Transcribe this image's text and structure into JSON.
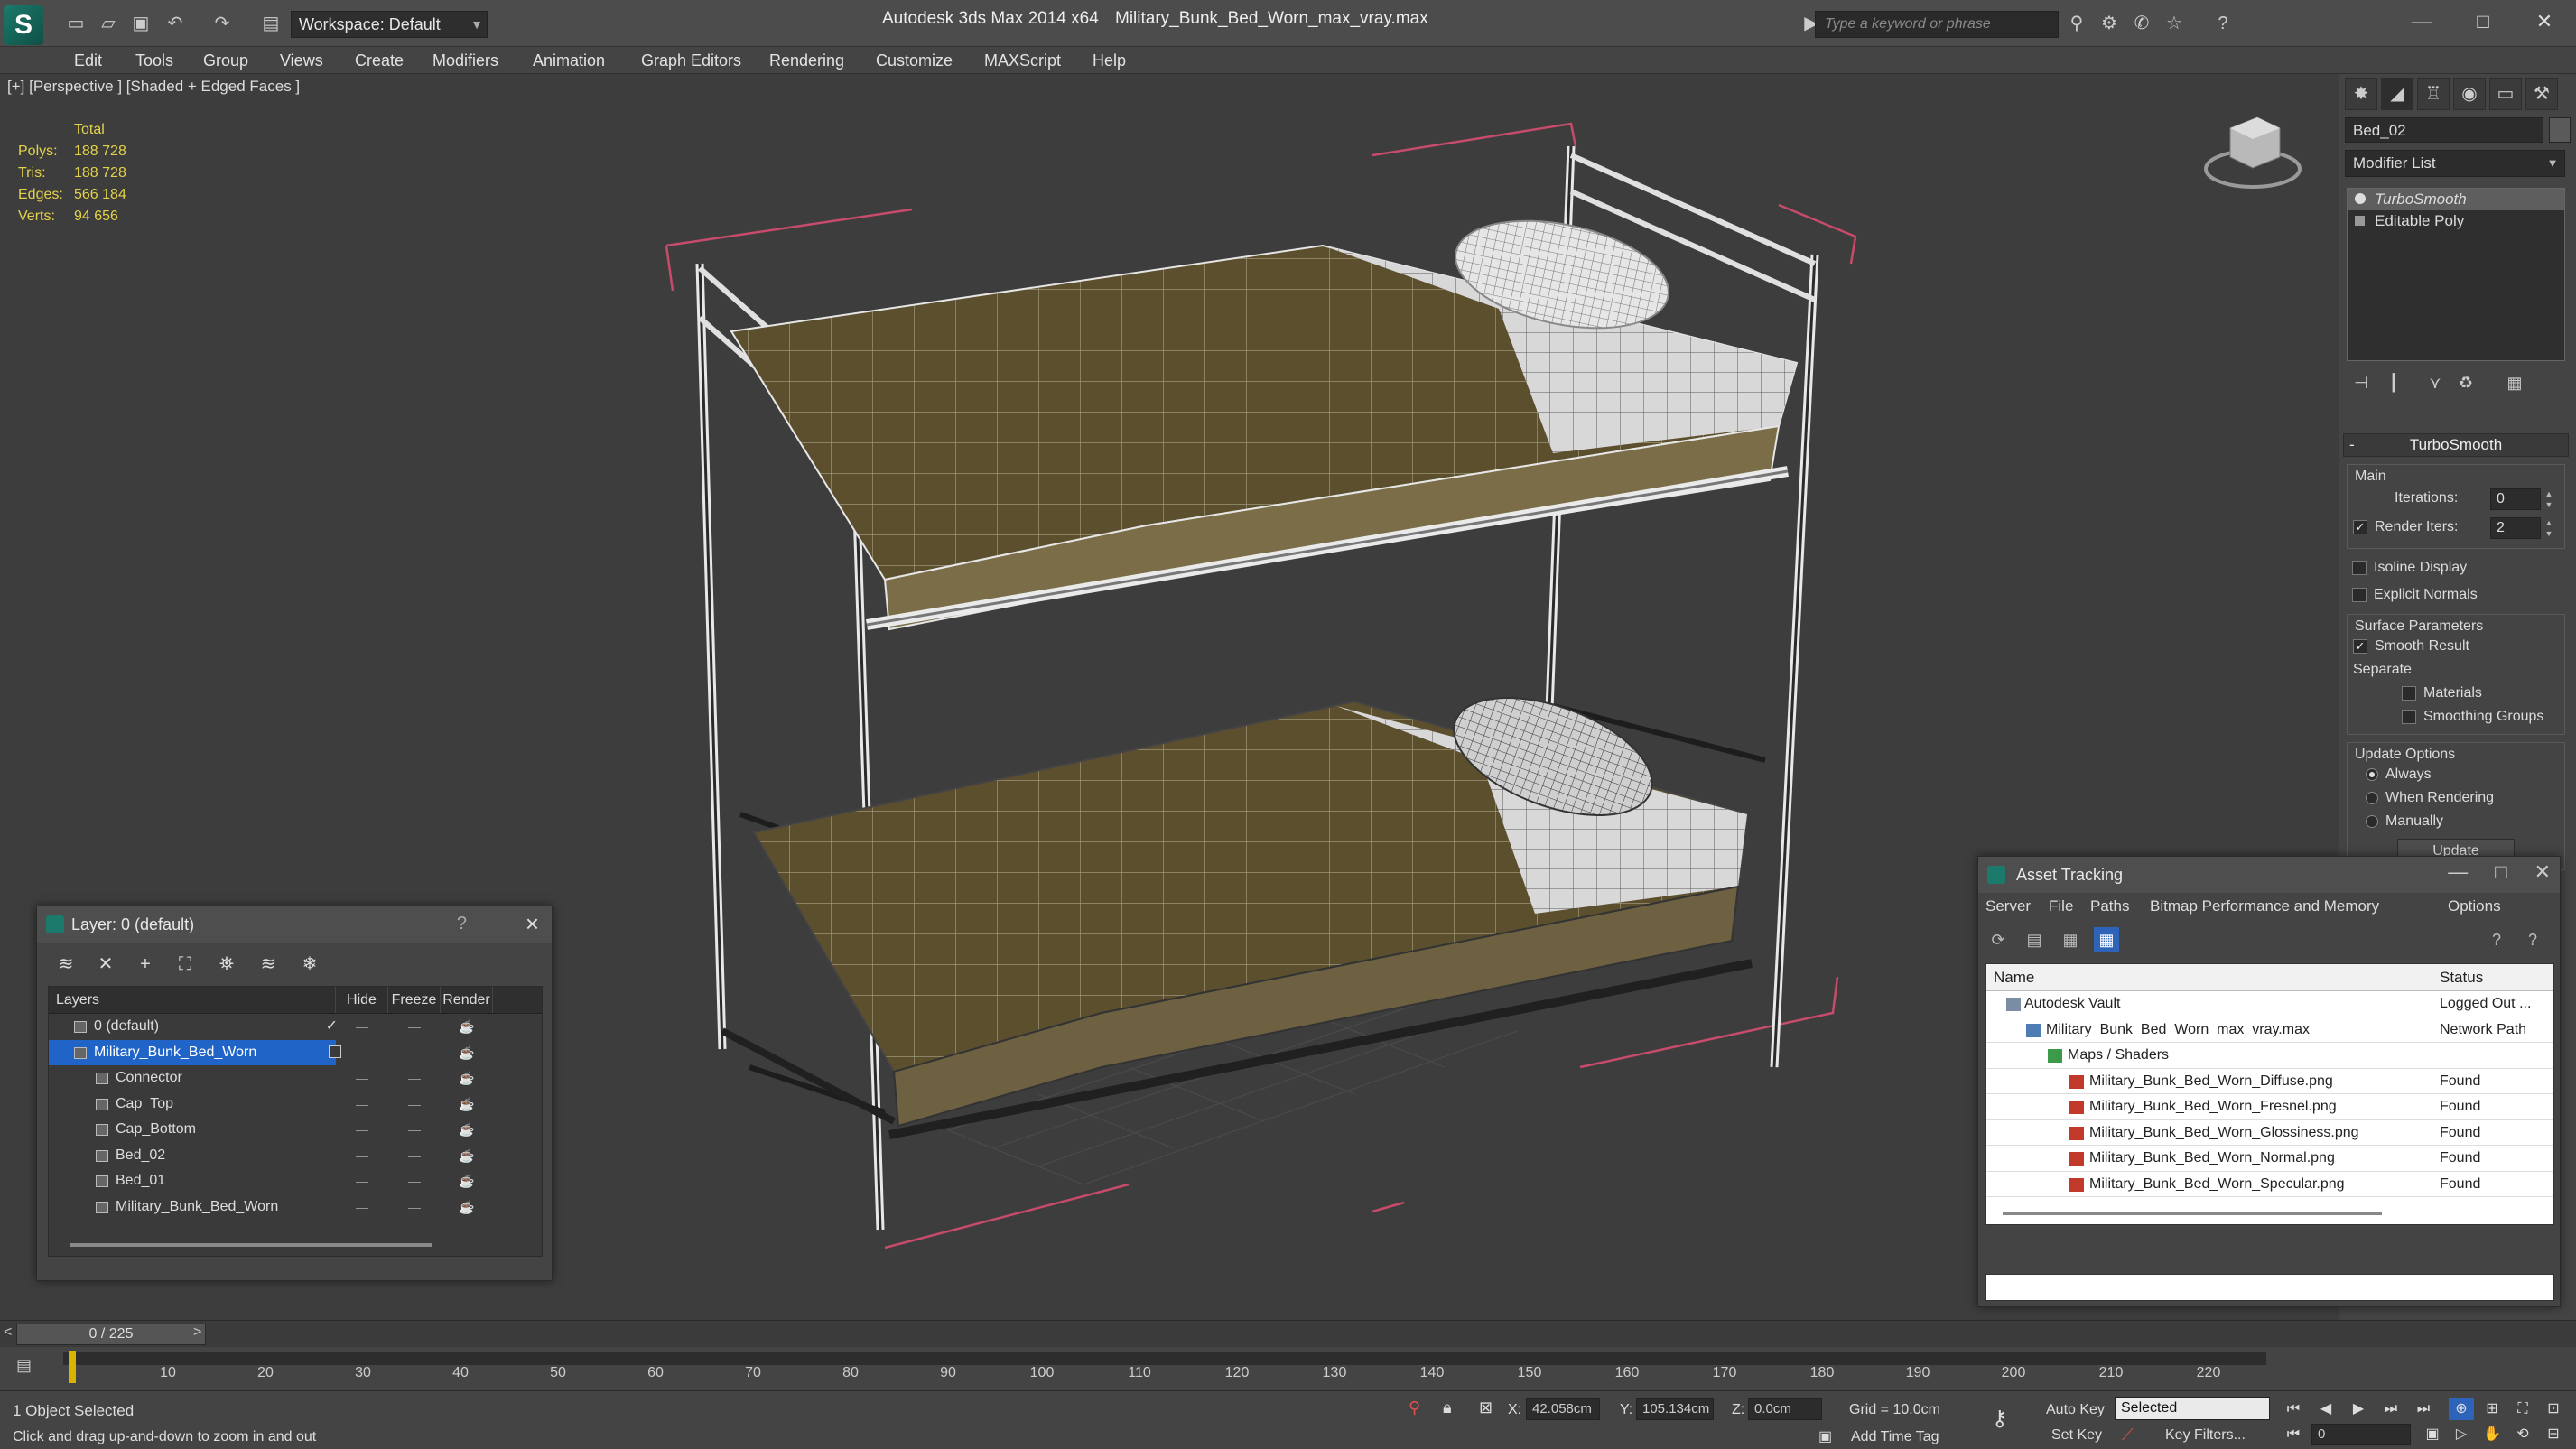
{
  "titlebar": {
    "workspace": "Workspace: Default",
    "app": "Autodesk 3ds Max  2014 x64",
    "file": "Military_Bunk_Bed_Worn_max_vray.max",
    "search_placeholder": "Type a keyword or phrase"
  },
  "menu": [
    "Edit",
    "Tools",
    "Group",
    "Views",
    "Create",
    "Modifiers",
    "Animation",
    "Graph Editors",
    "Rendering",
    "Customize",
    "MAXScript",
    "Help"
  ],
  "viewport": {
    "label": "[+] [Perspective ] [Shaded + Edged Faces ]",
    "stats": {
      "total": "Total",
      "rows": [
        {
          "k": "Polys:",
          "v": "188 728"
        },
        {
          "k": "Tris:",
          "v": "188 728"
        },
        {
          "k": "Edges:",
          "v": "566 184"
        },
        {
          "k": "Verts:",
          "v": "94 656"
        }
      ]
    }
  },
  "command_panel": {
    "object_name": "Bed_02",
    "modifier_list": "Modifier List",
    "stack": [
      "TurboSmooth",
      "Editable Poly"
    ],
    "turbosmooth": {
      "title": "TurboSmooth",
      "main": "Main",
      "iterations_label": "Iterations:",
      "iterations": "0",
      "render_iters_label": "Render Iters:",
      "render_iters": "2",
      "isoline": "Isoline Display",
      "explicit_normals": "Explicit Normals",
      "surface_params": "Surface Parameters",
      "smooth_result": "Smooth Result",
      "separate": "Separate",
      "materials": "Materials",
      "smoothing_groups": "Smoothing Groups",
      "update_options": "Update Options",
      "always": "Always",
      "when_rendering": "When Rendering",
      "manually": "Manually",
      "update_btn": "Update"
    }
  },
  "layer_window": {
    "title": "Layer: 0 (default)",
    "headers": {
      "name": "Layers",
      "hide": "Hide",
      "freeze": "Freeze",
      "render": "Render"
    },
    "rows": [
      {
        "name": "0 (default)"
      },
      {
        "name": "Military_Bunk_Bed_Worn"
      },
      {
        "name": "Connector"
      },
      {
        "name": "Cap_Top"
      },
      {
        "name": "Cap_Bottom"
      },
      {
        "name": "Bed_02"
      },
      {
        "name": "Bed_01"
      },
      {
        "name": "Military_Bunk_Bed_Worn"
      }
    ]
  },
  "asset_window": {
    "title": "Asset Tracking",
    "menu": [
      "Server",
      "File",
      "Paths",
      "Bitmap Performance and Memory",
      "Options"
    ],
    "headers": {
      "name": "Name",
      "status": "Status"
    },
    "rows": [
      {
        "name": "Autodesk Vault",
        "status": "Logged Out ..."
      },
      {
        "name": "Military_Bunk_Bed_Worn_max_vray.max",
        "status": "Network Path"
      },
      {
        "name": "Maps / Shaders",
        "status": ""
      },
      {
        "name": "Military_Bunk_Bed_Worn_Diffuse.png",
        "status": "Found"
      },
      {
        "name": "Military_Bunk_Bed_Worn_Fresnel.png",
        "status": "Found"
      },
      {
        "name": "Military_Bunk_Bed_Worn_Glossiness.png",
        "status": "Found"
      },
      {
        "name": "Military_Bunk_Bed_Worn_Normal.png",
        "status": "Found"
      },
      {
        "name": "Military_Bunk_Bed_Worn_Specular.png",
        "status": "Found"
      }
    ]
  },
  "timeline": {
    "frame": "0 / 225",
    "ticks": [
      "10",
      "20",
      "30",
      "40",
      "50",
      "60",
      "70",
      "80",
      "90",
      "100",
      "110",
      "120",
      "130",
      "140",
      "150",
      "160",
      "170",
      "180",
      "190",
      "200",
      "210",
      "220"
    ]
  },
  "status": {
    "selection": "1 Object Selected",
    "prompt": "Click and drag up-and-down to zoom in and out",
    "x_label": "X:",
    "x": "42.058cm",
    "y_label": "Y:",
    "y": "105.134cm",
    "z_label": "Z:",
    "z": "0.0cm",
    "grid": "Grid = 10.0cm",
    "add_time_tag": "Add Time Tag",
    "auto_key": "Auto Key",
    "set_key": "Set Key",
    "selected": "Selected",
    "key_filters": "Key Filters...",
    "current_frame": "0"
  }
}
